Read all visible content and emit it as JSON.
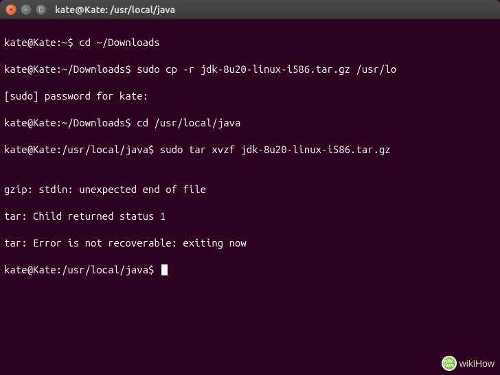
{
  "titlebar": {
    "title": "kate@Kate: /usr/local/java"
  },
  "terminal": {
    "lines": [
      "kate@Kate:~$ cd ~/Downloads",
      "kate@Kate:~/Downloads$ sudo cp -r jdk-8u20-linux-i586.tar.gz /usr/lo",
      "[sudo] password for kate:",
      "kate@Kate:~/Downloads$ cd /usr/local/java",
      "kate@Kate:/usr/local/java$ sudo tar xvzf jdk-8u20-linux-i586.tar.gz",
      "",
      "gzip: stdin: unexpected end of file",
      "tar: Child returned status 1",
      "tar: Error is not recoverable: exiting now"
    ],
    "prompt": "kate@Kate:/usr/local/java$ "
  },
  "watermark": {
    "text": "wikiHow"
  }
}
